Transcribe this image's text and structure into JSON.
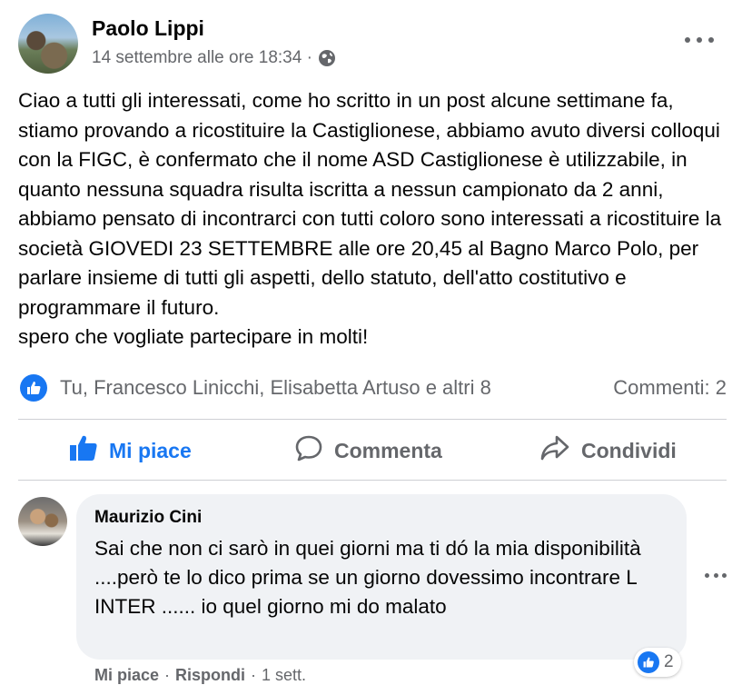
{
  "post": {
    "author": "Paolo Lippi",
    "timestamp": "14 settembre alle ore 18:34 ·",
    "privacy_icon": "globe-icon",
    "text": "Ciao a tutti gli interessati, come ho scritto in un post alcune settimane fa, stiamo provando a ricostituire la Castiglionese, abbiamo avuto diversi colloqui con la FIGC, è confermato che il nome ASD Castiglionese è utilizzabile, in quanto nessuna squadra risulta iscritta a nessun campionato da 2 anni, abbiamo pensato di incontrarci con tutti coloro sono interessati a ricostituire la società GIOVEDI 23 SETTEMBRE alle ore 20,45 al Bagno Marco Polo, per parlare insieme di tutti gli aspetti, dello statuto, dell'atto costitutivo e programmare il futuro.\nspero che vogliate partecipare in molti!",
    "reactions_text": "Tu, Francesco Linicchi, Elisabetta Artuso e altri 8",
    "comments_count": "Commenti: 2"
  },
  "actions": {
    "like": "Mi piace",
    "comment": "Commenta",
    "share": "Condividi"
  },
  "comment": {
    "author": "Maurizio Cini",
    "text": "Sai che non ci sarò in quei giorni ma ti dó la mia disponibilità ....però te lo dico prima se un giorno dovessimo incontrare L INTER ...... io quel giorno mi do malato",
    "reaction_count": "2",
    "like_label": "Mi piace",
    "sep1": "·",
    "reply_label": "Rispondi",
    "sep2": "·",
    "age": "1 sett."
  },
  "colors": {
    "accent": "#1877f2",
    "secondary_text": "#65676b",
    "bubble": "#f0f2f5"
  }
}
